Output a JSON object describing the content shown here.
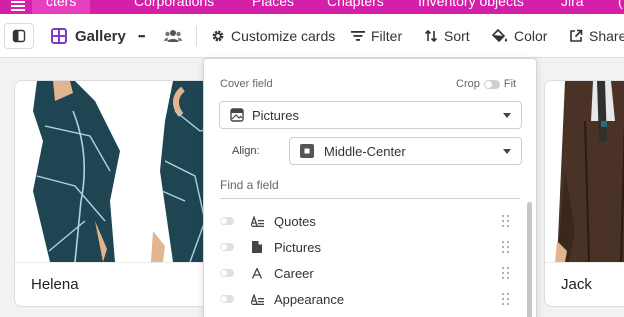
{
  "tabs": [
    {
      "label": "cters",
      "active": true
    },
    {
      "label": "Corporations"
    },
    {
      "label": "Places"
    },
    {
      "label": "Chapters"
    },
    {
      "label": "Inventory objects"
    },
    {
      "label": "Jira"
    },
    {
      "label": "("
    }
  ],
  "toolbar": {
    "view_name": "Gallery",
    "more_label": "•••",
    "customize_cards": "Customize cards",
    "filter": "Filter",
    "sort": "Sort",
    "color": "Color",
    "share": "Share"
  },
  "cards": [
    {
      "name": "Helena"
    },
    {
      "name": "Jack"
    }
  ],
  "popover": {
    "cover_field_label": "Cover field",
    "crop_label": "Crop",
    "fit_label": "Fit",
    "cover_value": "Pictures",
    "align_label": "Align:",
    "align_value": "Middle-Center",
    "find_placeholder": "Find a field",
    "fields": [
      {
        "name": "Quotes",
        "icon": "long-text-icon"
      },
      {
        "name": "Pictures",
        "icon": "attachment-icon"
      },
      {
        "name": "Career",
        "icon": "single-line-text-icon"
      },
      {
        "name": "Appearance",
        "icon": "long-text-icon"
      }
    ]
  },
  "colors": {
    "tab_bar": "#d41fa9",
    "gallery_accent": "#7b3fc4",
    "character_suit": "#1f4552"
  }
}
